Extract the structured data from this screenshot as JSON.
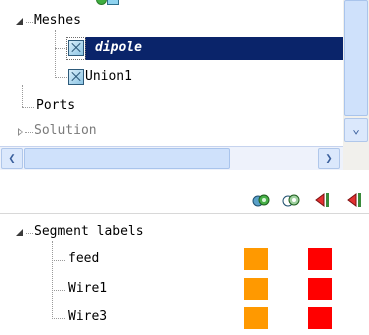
{
  "tree": {
    "partial_top_label": "",
    "meshes_label": "Meshes",
    "mesh_items": [
      {
        "label": "dipole",
        "selected": true
      },
      {
        "label": "Union1",
        "selected": false
      }
    ],
    "ports_label": "Ports",
    "solution_label": "Solution"
  },
  "scrollbars": {
    "vertical_down_icon": "chevron-down-icon",
    "horizontal_left_icon": "chevron-left-icon",
    "horizontal_right_icon": "chevron-right-icon"
  },
  "toolbar": {
    "buttons": [
      {
        "icon": "view-green-icon"
      },
      {
        "icon": "view-outline-icon"
      },
      {
        "icon": "port-red-icon"
      },
      {
        "icon": "port-red-partial-icon"
      }
    ]
  },
  "segments": {
    "header_label": "Segment labels",
    "items": [
      {
        "label": "feed",
        "color_a": "#ff9900",
        "color_b": "#ff0000"
      },
      {
        "label": "Wire1",
        "color_a": "#ff9900",
        "color_b": "#ff0000"
      },
      {
        "label": "Wire3",
        "color_a": "#ff9900",
        "color_b": "#ff0000"
      }
    ]
  },
  "colors": {
    "selection_bg": "#0a246a",
    "scroll_thumb": "#cfe1fb",
    "orange": "#ff9900",
    "red": "#ff0000"
  }
}
